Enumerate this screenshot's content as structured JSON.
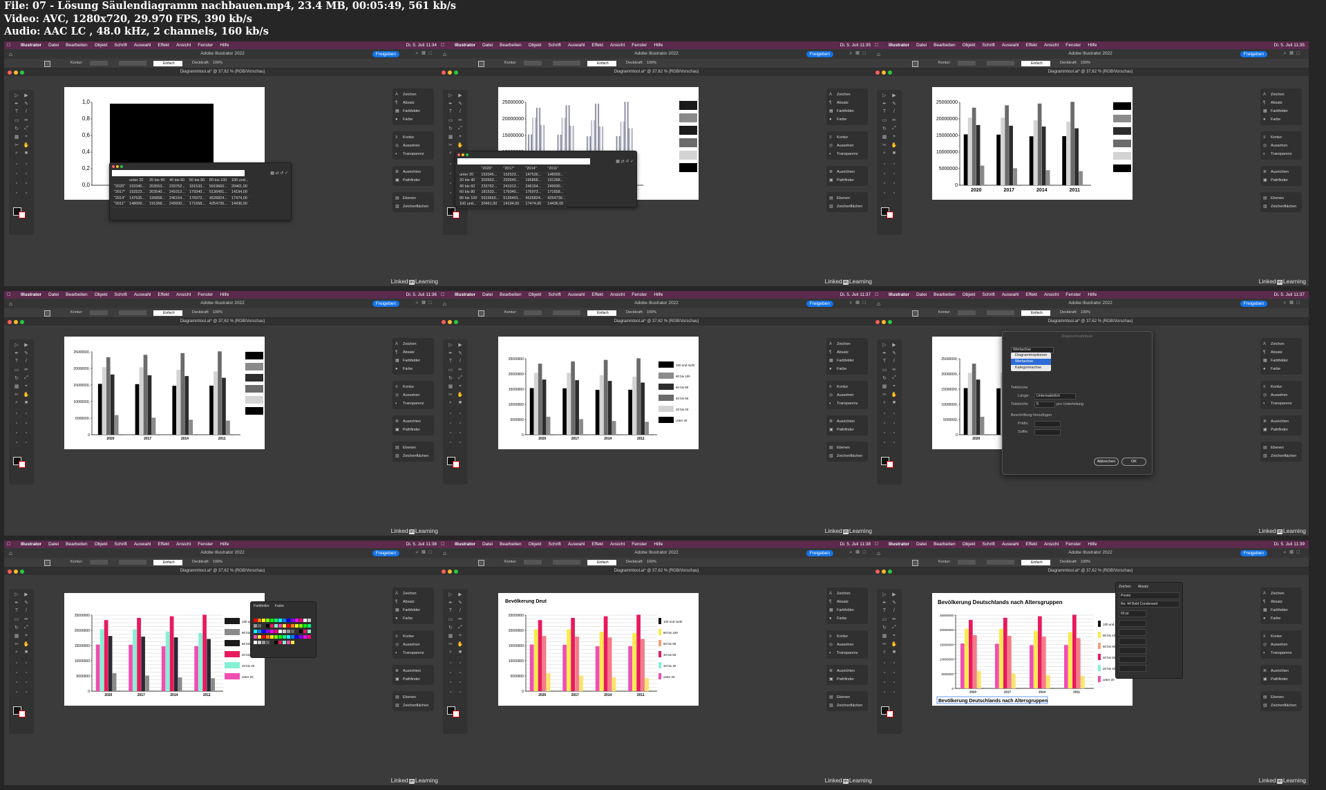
{
  "meta": {
    "file": "File: 07 - Lösung Säulendiagramm nachbauen.mp4, 23.4 MB, 00:05:49, 561 kb/s",
    "video": "Video: AVC, 1280x720, 29.970 FPS, 390 kb/s",
    "audio": "Audio: AAC LC , 48.0 kHz, 2 channels, 160 kb/s"
  },
  "app": {
    "menu": [
      "Illustrator",
      "Datei",
      "Bearbeiten",
      "Objekt",
      "Schrift",
      "Auswahl",
      "Effekt",
      "Ansicht",
      "Fenster",
      "Hilfe"
    ],
    "title": "Adobe Illustrator 2022",
    "share": "Freigeben",
    "doc_tab": "Diagrammtool.ai* @ 37,62 % (RGB/Vorschau)",
    "kontur": "Kontur:",
    "stroke": "Einfach",
    "deckkraft": "Deckkraft:",
    "opacity": "100%",
    "panels": [
      [
        "Zeichen",
        "Absatz",
        "Farbfelder",
        "Farbe"
      ],
      [
        "Kontur",
        "Aussehen",
        "Transparenz"
      ],
      [
        "Ausrichten",
        "Pathfinder"
      ],
      [
        "Ebenen",
        "Zeichenflächen"
      ]
    ],
    "watermark_a": "Linked",
    "watermark_b": "in",
    "watermark_c": "Learning"
  },
  "chart_data": {
    "type": "bar",
    "categories": [
      "2020",
      "2017",
      "2014",
      "2011"
    ],
    "series": [
      {
        "name": "unter 20",
        "values": [
          15334500,
          15252300,
          14753500,
          14800900
        ]
      },
      {
        "name": "20 bis 40",
        "values": [
          20355300,
          20354000,
          19585800,
          19136800
        ]
      },
      {
        "name": "40 bis 60",
        "values": [
          23375200,
          24101200,
          24616400,
          25136400
        ]
      },
      {
        "name": "60 bis 80",
        "values": [
          18153300,
          17934000,
          17697300,
          17165800
        ]
      },
      {
        "name": "80 bis 100",
        "values": [
          5919660,
          5136491,
          4526824,
          4254736
        ]
      },
      {
        "name": "100 und mehr",
        "values": [
          20461,
          14194,
          17474,
          14436
        ]
      }
    ],
    "legend_order": [
      "100 und mehr",
      "80 bis 100",
      "60 bis 80",
      "40 bis 60",
      "20 bis 40",
      "unter 20"
    ],
    "y_ticks": [
      "0",
      "5000000",
      "10000000",
      "15000000",
      "20000000",
      "25000000"
    ],
    "y_ticks_dotted": [
      "0",
      "5000000,",
      "10000000,",
      "15000000,",
      "20000000,",
      "25000000,"
    ],
    "y_ticks_unit": [
      "0,0",
      "0,2",
      "0,4",
      "0,6",
      "0,8",
      "1,0"
    ],
    "ylim": [
      0,
      25000000
    ],
    "title": "Bevölkerung Deutschlands nach Altersgruppen",
    "title_partial": "Bevölkerung Deut"
  },
  "colors": {
    "gray": [
      "#000000",
      "#d3d3d3",
      "#6b6b6b",
      "#2c2c2c",
      "#8a8a8a",
      "#111111"
    ],
    "gray_legend": [
      "#000000",
      "#8a8a8a",
      "#2c2c2c",
      "#6b6b6b",
      "#d3d3d3",
      "#000000"
    ],
    "color": [
      "#ef4fb0",
      "#86f0d6",
      "#e8195c",
      "#2a2a34",
      "#8a8a8a",
      "#111111"
    ],
    "color_legend": [
      "#1a1a1a",
      "#8a8a8a",
      "#1a1a1a",
      "#e8195c",
      "#86f0d6",
      "#ef4fb0"
    ],
    "final": [
      "#ef4fb0",
      "#fde94a",
      "#e8195c",
      "#f47c86",
      "#fbe46b",
      "#111111"
    ],
    "final_legend": [
      "#111111",
      "#fde94a",
      "#f4a07a",
      "#e8195c",
      "#86f0d6",
      "#ef4fb0"
    ],
    "menubar": "#5b2a4c",
    "share": "#1473e6"
  },
  "datawin": {
    "cols": [
      "",
      "unter 20",
      "20 bis 40",
      "40 bis 60",
      "60 bis 80",
      "80 bis 100",
      "100 und..."
    ],
    "rows": [
      [
        "\"2020\"",
        "153345...",
        "203553...",
        "233752...",
        "181533...",
        "5919660...",
        "20461,00"
      ],
      [
        "\"2017\"",
        "152523...",
        "203540...",
        "241012...",
        "179340...",
        "5136491...",
        "14194,00"
      ],
      [
        "\"2014\"",
        "147535...",
        "195858...",
        "246164...",
        "176973...",
        "4526824...",
        "17474,00"
      ],
      [
        "\"2011\"",
        "148009...",
        "191368...",
        "249930...",
        "171658...",
        "4254736...",
        "14436,00"
      ]
    ],
    "cols_t": [
      "",
      "\"2020\"",
      "\"2017\"",
      "\"2014\"",
      "\"2011\""
    ],
    "rows_t": [
      [
        "unter 20",
        "153345...",
        "152523...",
        "147535...",
        "148009..."
      ],
      [
        "20 bis 40",
        "203553...",
        "203540...",
        "195858...",
        "191368..."
      ],
      [
        "40 bis 60",
        "233752...",
        "241012...",
        "246164...",
        "249930..."
      ],
      [
        "60 bis 80",
        "181533...",
        "179340...",
        "176973...",
        "171658..."
      ],
      [
        "80 bis 100",
        "5919660...",
        "5136491...",
        "4526824...",
        "4254736..."
      ],
      [
        "100 und...",
        "20461,00",
        "14194,00",
        "17474,00",
        "14436,00"
      ]
    ]
  },
  "dialog": {
    "title": "Diagrammattribute",
    "dropdown": "Wertachse",
    "menu": [
      "Diagrammoptionen",
      "Wertachse",
      "Kategorieachse"
    ],
    "teilstriche": "Teilstriche",
    "laenge_label": "Länge:",
    "laenge_value": "Unternatürlich",
    "teilstriche_label": "Teilstriche:",
    "teilstriche_value": "5",
    "pro_unterteilung": "pro Unterteilung",
    "beschriftung": "Beschriftung hinzufügen",
    "praefix": "Präfix:",
    "suffix": "Suffix:",
    "cancel": "Abbrechen",
    "ok": "OK"
  },
  "swatch": {
    "tab1": "Farbfelder",
    "tab2": "Farbe"
  },
  "charpanel": {
    "tab1": "Zeichen",
    "tab2": "Absatz",
    "font": "Presto",
    "style": "No. 44 Bold Condensed",
    "size": "60 pt"
  },
  "frames": [
    {
      "clock": "Di. 5. Juli 11:34"
    },
    {
      "clock": "Di. 5. Juli 11:35"
    },
    {
      "clock": "Di. 5. Juli 11:35"
    },
    {
      "clock": "Di. 5. Juli 11:36"
    },
    {
      "clock": "Di. 5. Juli 11:37"
    },
    {
      "clock": "Di. 5. Juli 11:37"
    },
    {
      "clock": "Di. 5. Juli 11:38"
    },
    {
      "clock": "Di. 5. Juli 11:38"
    },
    {
      "clock": "Di. 5. Juli 11:39"
    }
  ]
}
